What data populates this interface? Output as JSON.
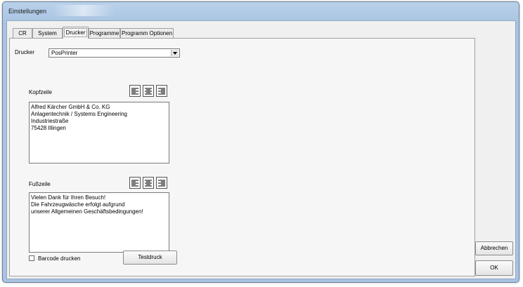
{
  "window": {
    "title": "Einstellungen"
  },
  "tabs": [
    {
      "label": "CR",
      "active": false
    },
    {
      "label": "System",
      "active": false
    },
    {
      "label": "Drucker",
      "active": true
    },
    {
      "label": "Programme",
      "active": false
    },
    {
      "label": "Programm Optionen",
      "active": false
    }
  ],
  "printer": {
    "label": "Drucker",
    "selected": "PosPrinter"
  },
  "header": {
    "label": "Kopfzeile",
    "lines": [
      "Alfred Kärcher GmbH & Co. KG",
      "Anlagentechnik / Systems Engineering",
      "Industriestraße",
      "75428 Illingen"
    ]
  },
  "footer": {
    "label": "Fußzeile",
    "lines": [
      "Vielen Dank für Ihren Besuch!",
      "Die Fahrzeugwäsche erfolgt aufgrund",
      "unserer Allgemeinen Geschäftsbedingungen!"
    ]
  },
  "align_icons": [
    "align-left-icon",
    "align-center-icon",
    "align-right-icon"
  ],
  "barcode": {
    "label": "Barcode drucken",
    "checked": false
  },
  "buttons": {
    "test_print": "Testdruck",
    "cancel": "Abbrechen",
    "ok": "OK"
  }
}
